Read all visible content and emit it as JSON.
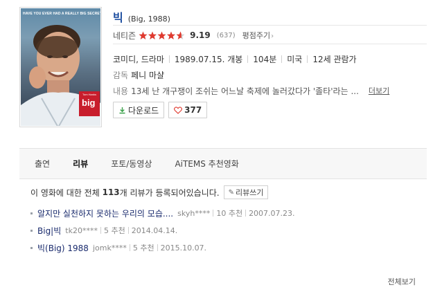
{
  "poster": {
    "tagline": "HAVE YOU EVER HAD A REALLY BIG SECRET?",
    "credit": "Tom Hanks",
    "title_mark": "big"
  },
  "movie": {
    "title": "빅",
    "subtitle": "(Big, 1988)",
    "rating_label": "네티즌",
    "rating_stars": 4.6,
    "rating_score": "9.19",
    "rating_count": "(637)",
    "evaluate_label": "평점주기",
    "genre": "코미디, 드라마",
    "release": "1989.07.15. 개봉",
    "runtime": "104분",
    "country": "미국",
    "age": "12세 관람가",
    "director_label": "감독",
    "director": "페니 마샬",
    "plot_label": "내용",
    "plot": "13세 난 개구쟁이 조쉬는 어느날 축제에 놀러갔다가 '졸타'라는 ...",
    "more_label": "더보기",
    "download_label": "다운로드",
    "like_count": "377"
  },
  "tabs": [
    {
      "label": "출연"
    },
    {
      "label": "리뷰"
    },
    {
      "label": "포토/동영상"
    },
    {
      "label": "AiTEMS 추천영화"
    }
  ],
  "reviews": {
    "head_prefix": "이 영화에 대한 전체 ",
    "count": "113",
    "head_suffix": "개 리뷰가 등록되어있습니다.",
    "write_label": "리뷰쓰기",
    "items": [
      {
        "title": "알지만 실천하지 못하는 우리의 모습....",
        "user": "skyh****",
        "recommend": "10 추천",
        "date": "2007.07.23."
      },
      {
        "title": "Big|빅",
        "user": "tk20****",
        "recommend": "5 추천",
        "date": "2014.04.14."
      },
      {
        "title": "빅(Big) 1988",
        "user": "jomk****",
        "recommend": "5 추천",
        "date": "2015.10.07."
      }
    ],
    "see_all": "전체보기"
  },
  "colors": {
    "star": "#e0392e",
    "title": "#1f4fa0",
    "review_title": "#1a2b6d",
    "download_icon": "#3aa04a"
  }
}
